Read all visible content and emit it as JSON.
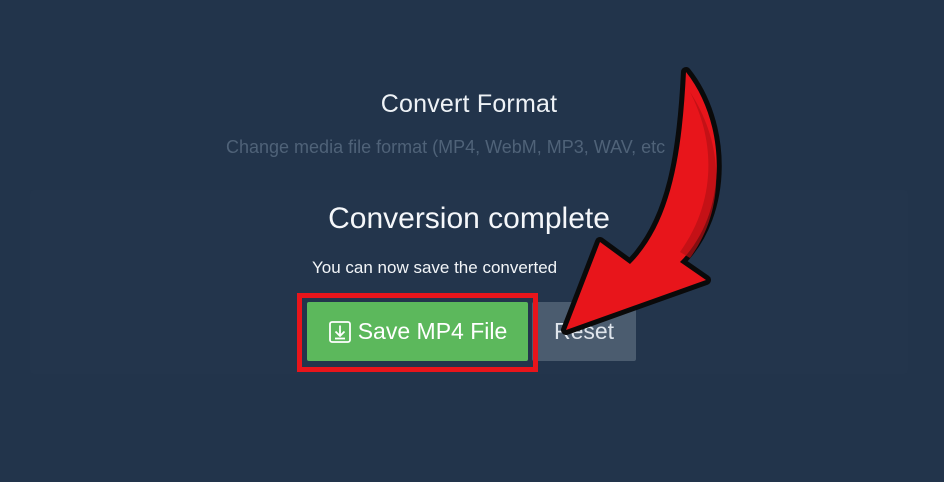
{
  "tool": {
    "title": "Convert Format",
    "subtitle": "Change media file format (MP4, WebM, MP3, WAV, etc"
  },
  "result": {
    "heading": "Conversion complete",
    "message": "You can now save the converted"
  },
  "actions": {
    "save_label": "Save MP4 File",
    "save_icon": "download-icon",
    "reset_label": "Reset"
  },
  "annotation": {
    "highlight_color": "#e8151b",
    "arrow_color": "#e8151b"
  },
  "colors": {
    "background": "#22344b",
    "save_button": "#5cb85c",
    "reset_button": "#4b5c6f"
  }
}
